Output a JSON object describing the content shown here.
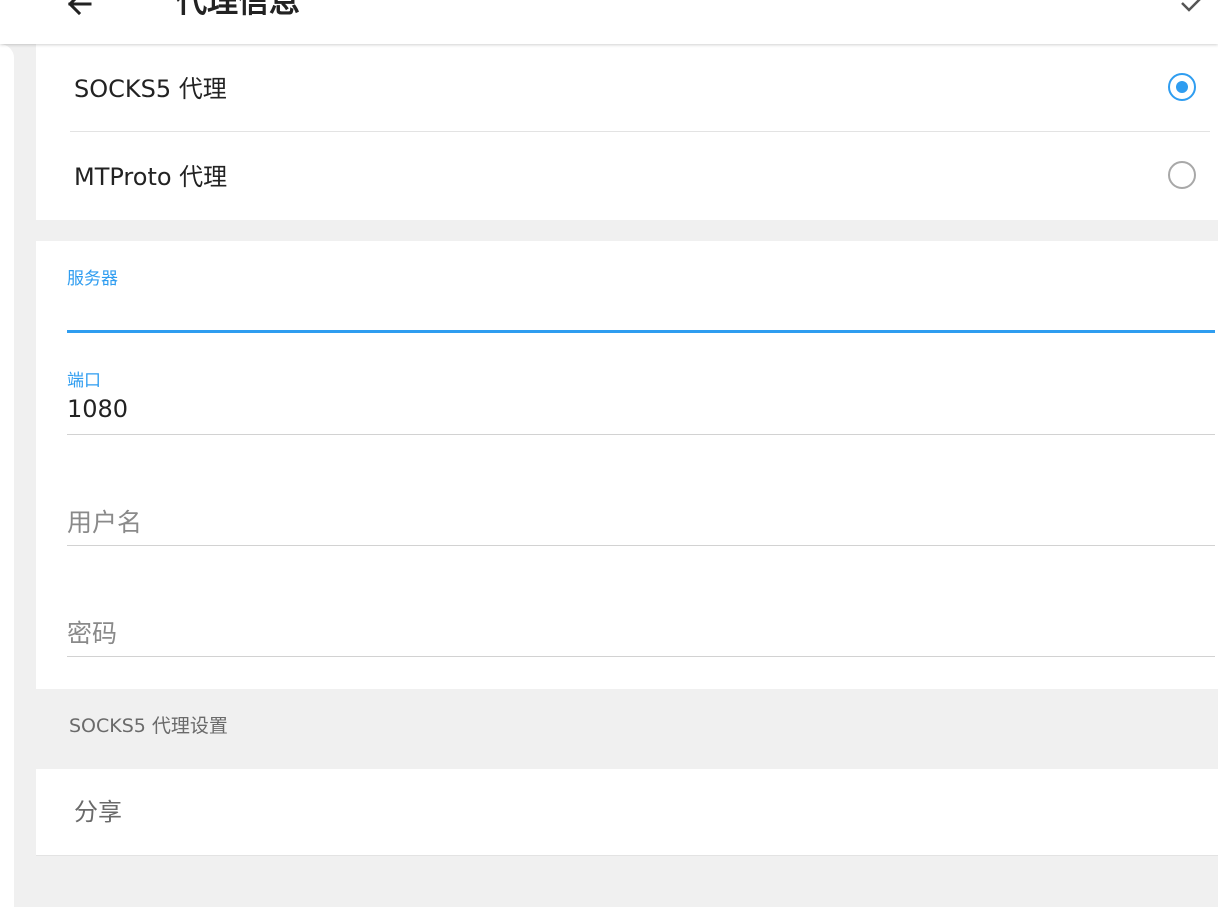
{
  "topbar": {
    "title": "代理信息",
    "back_icon": "arrow-left-icon",
    "confirm_icon": "check-icon"
  },
  "proxy_types": [
    {
      "label": "SOCKS5 代理",
      "selected": true
    },
    {
      "label": "MTProto 代理",
      "selected": false
    }
  ],
  "fields": {
    "server": {
      "label": "服务器",
      "value": ""
    },
    "port": {
      "label": "端口",
      "value": "1080"
    },
    "username": {
      "placeholder": "用户名"
    },
    "password": {
      "placeholder": "密码"
    }
  },
  "section_footer": "SOCKS5 代理设置",
  "share_label": "分享",
  "colors": {
    "accent": "#2f9df0",
    "background": "#f0f0f0",
    "card": "#ffffff"
  }
}
